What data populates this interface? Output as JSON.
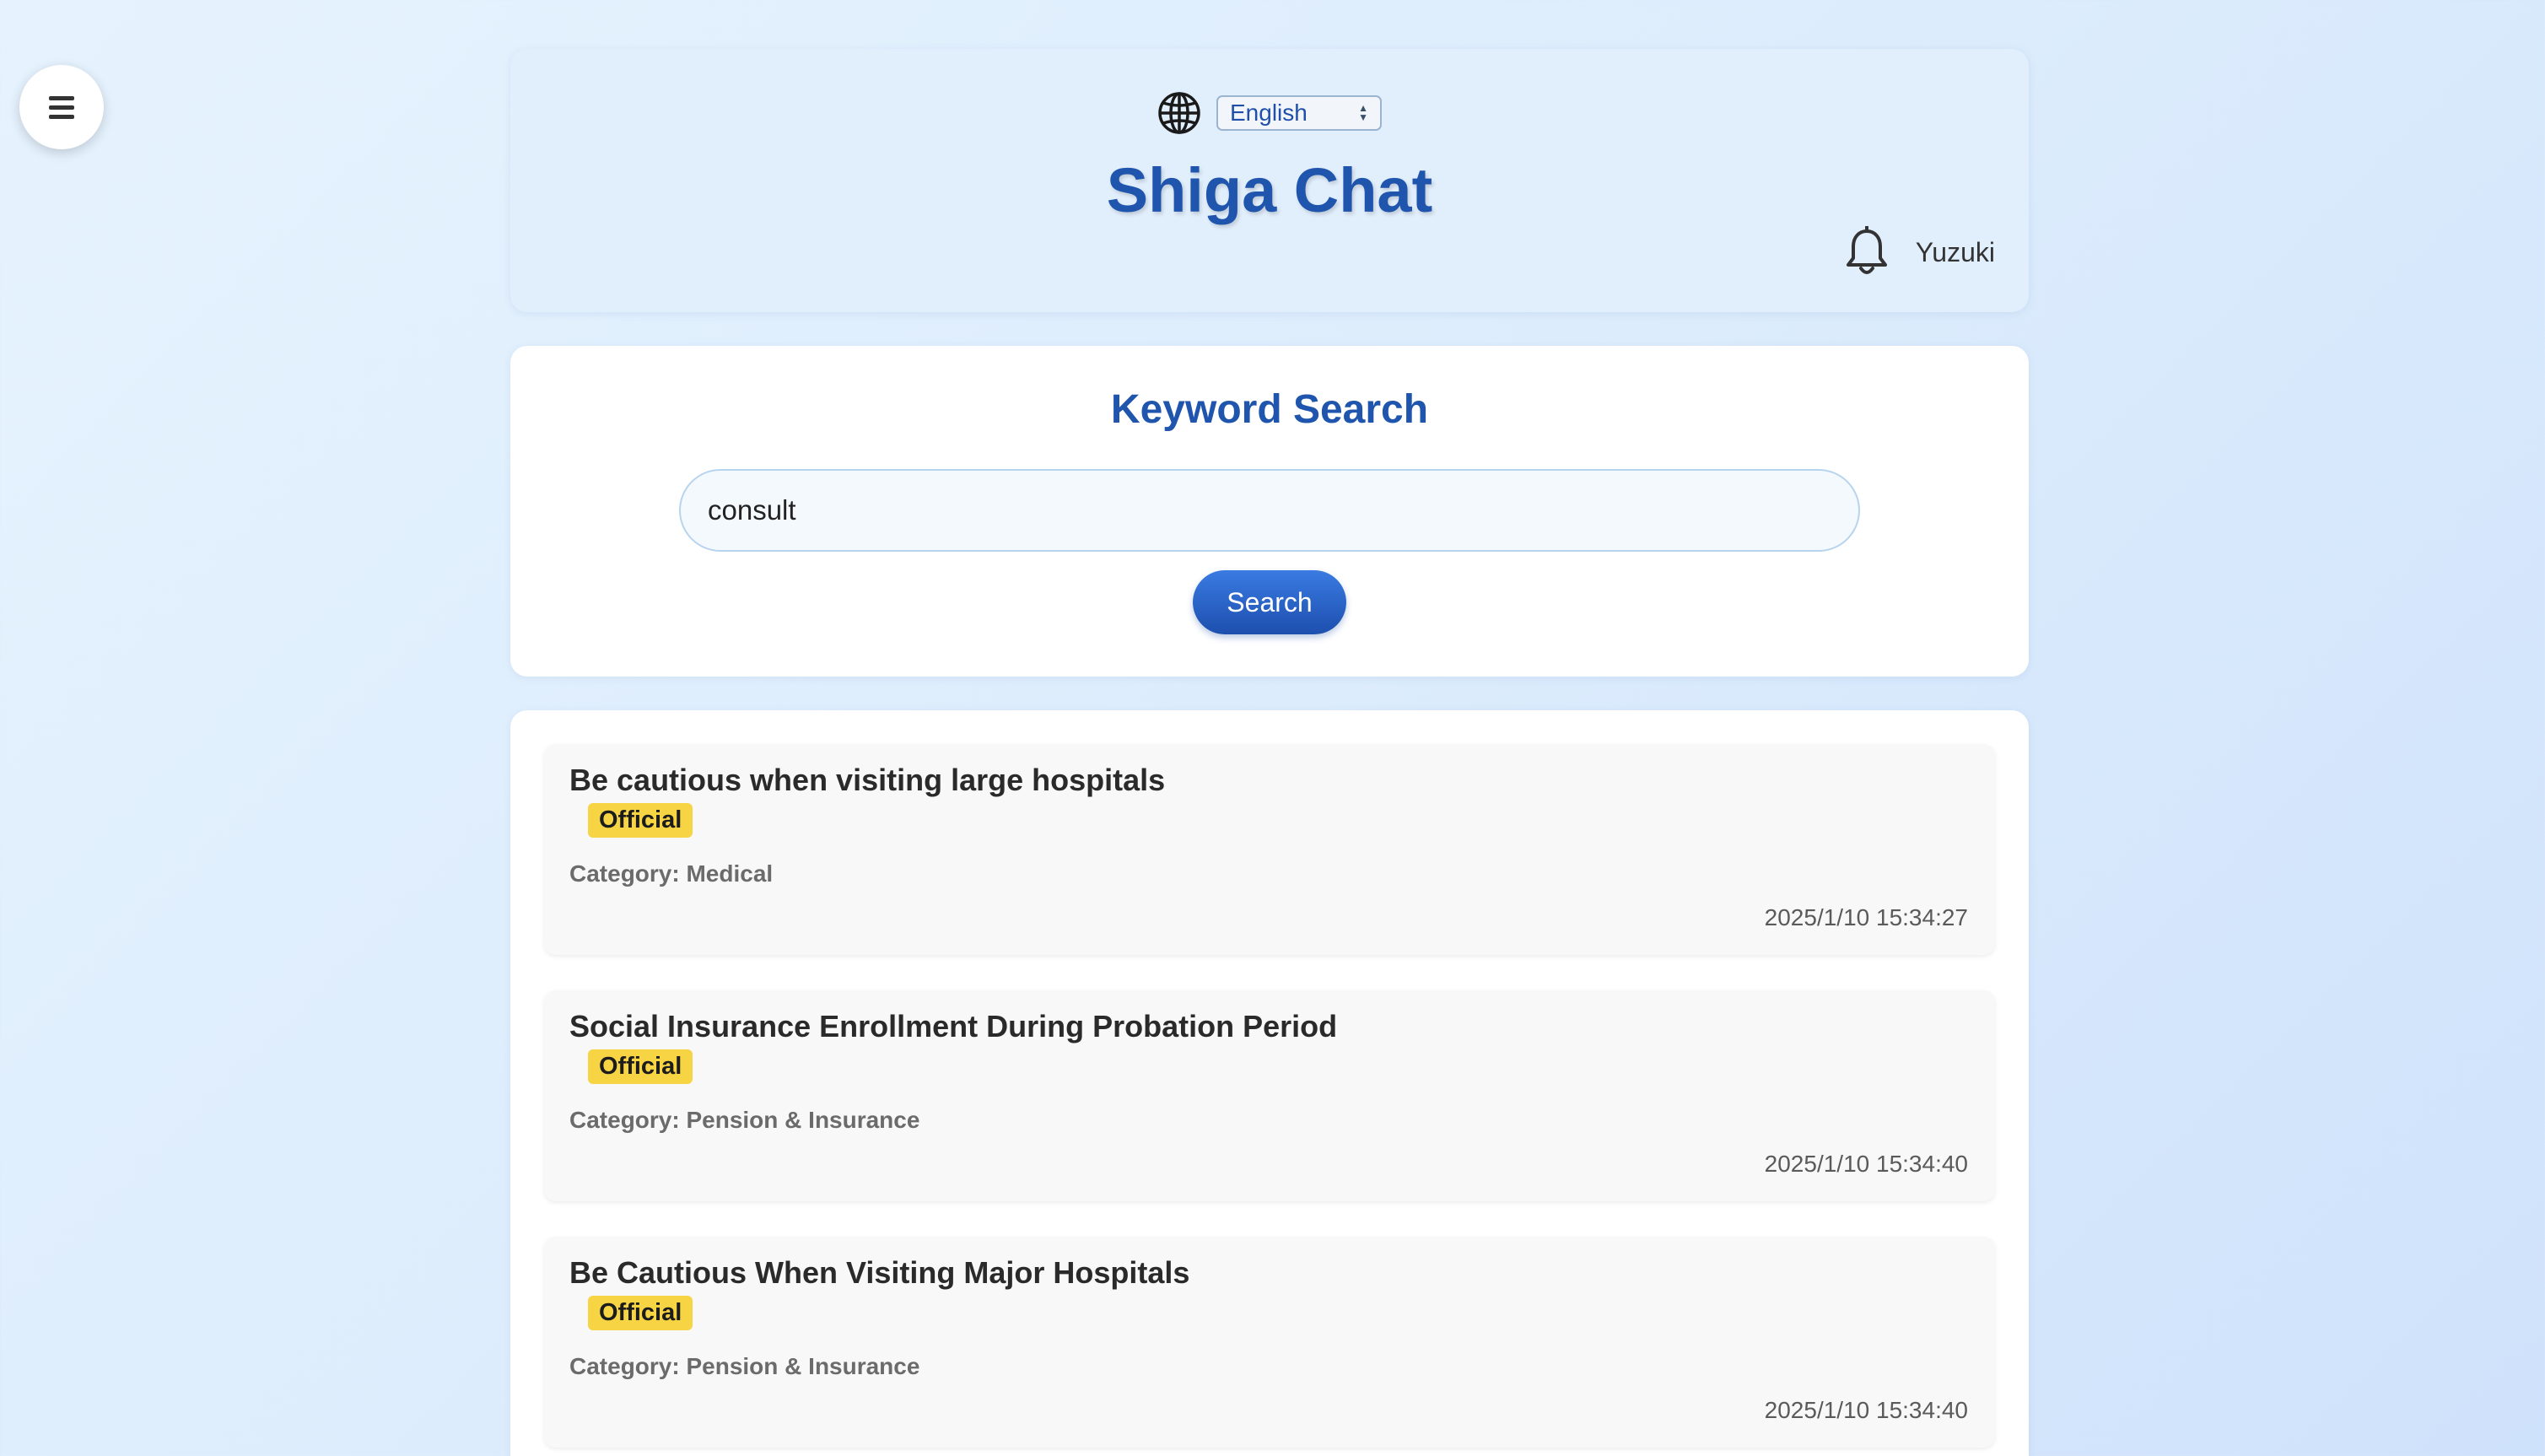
{
  "header": {
    "language_selected": "English",
    "app_title": "Shiga Chat",
    "username": "Yuzuki"
  },
  "search": {
    "title": "Keyword Search",
    "query": "consult",
    "button_label": "Search"
  },
  "results": [
    {
      "title": "Be cautious when visiting large hospitals",
      "badge": "Official",
      "category": "Category: Medical",
      "date": "2025/1/10 15:34:27"
    },
    {
      "title": "Social Insurance Enrollment During Probation Period",
      "badge": "Official",
      "category": "Category: Pension & Insurance",
      "date": "2025/1/10 15:34:40"
    },
    {
      "title": "Be Cautious When Visiting Major Hospitals",
      "badge": "Official",
      "category": "Category: Pension & Insurance",
      "date": "2025/1/10 15:34:40"
    }
  ],
  "colors": {
    "accent": "#1f55ad",
    "badge": "#f7d443",
    "button": "#2a66cc"
  },
  "icons": {
    "menu": "hamburger-menu-icon",
    "language": "globe-icon",
    "notifications": "bell-icon"
  }
}
